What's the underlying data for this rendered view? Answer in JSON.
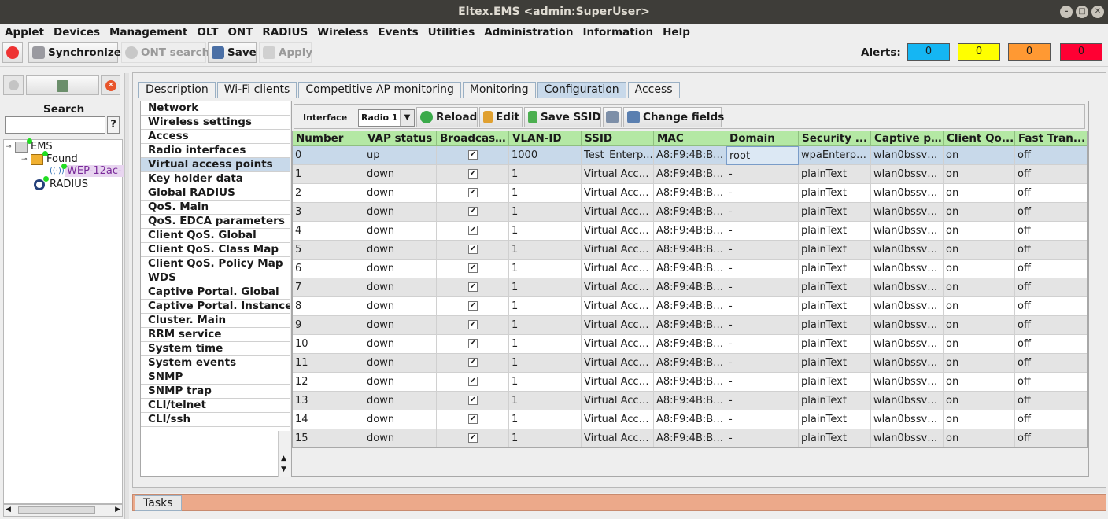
{
  "window": {
    "title": "Eltex.EMS <admin:SuperUser>"
  },
  "menu": [
    "Applet",
    "Devices",
    "Management",
    "OLT",
    "ONT",
    "RADIUS",
    "Wireless",
    "Events",
    "Utilities",
    "Administration",
    "Information",
    "Help"
  ],
  "toolbar": {
    "synchronize": "Synchronize",
    "ont_search": "ONT search",
    "save": "Save",
    "apply": "Apply"
  },
  "alerts": {
    "label": "Alerts:",
    "values": [
      "0",
      "0",
      "0",
      "0"
    ],
    "colors": [
      "#15b6f3",
      "#ffff00",
      "#ff9933",
      "#ff0033"
    ]
  },
  "left": {
    "search_label": "Search",
    "search_btn": "?",
    "tree": {
      "root": "EMS",
      "found": "Found",
      "device": "WEP-12ac-",
      "radius": "RADIUS"
    }
  },
  "tabs": [
    "Description",
    "Wi-Fi clients",
    "Competitive AP monitoring",
    "Monitoring",
    "Configuration",
    "Access"
  ],
  "active_tab": "Configuration",
  "nav": [
    "Network",
    "Wireless settings",
    "Access",
    "Radio interfaces",
    "Virtual access points",
    "Key holder data",
    "Global RADIUS",
    "QoS. Main",
    "QoS. EDCA parameters",
    "Client QoS. Global",
    "Client QoS. Class Map",
    "Client QoS. Policy Map",
    "WDS",
    "Captive Portal. Global",
    "Captive Portal. Instance",
    "Cluster. Main",
    "RRM service",
    "System time",
    "System events",
    "SNMP",
    "SNMP trap",
    "CLI/telnet",
    "CLI/ssh"
  ],
  "selected_nav": "Virtual access points",
  "iface": {
    "label": "Interface",
    "value": "Radio 1",
    "reload": "Reload",
    "edit": "Edit",
    "save_ssid": "Save SSID",
    "change_fields": "Change fields"
  },
  "table": {
    "columns": [
      "Number",
      "VAP status",
      "Broadcast...",
      "VLAN-ID",
      "SSID",
      "MAC",
      "Domain",
      "Security ...",
      "Captive p...",
      "Client Qo...",
      "Fast Tran..."
    ],
    "rows": [
      [
        "0",
        "up",
        "✔",
        "1000",
        "Test_Enterp...",
        "A8:F9:4B:B0...",
        "root",
        "wpaEnterpri...",
        "wlan0bssvap0",
        "on",
        "off"
      ],
      [
        "1",
        "down",
        "✔",
        "1",
        "Virtual Acce...",
        "A8:F9:4B:B0...",
        "-",
        "plainText",
        "wlan0bssvap1",
        "on",
        "off"
      ],
      [
        "2",
        "down",
        "✔",
        "1",
        "Virtual Acce...",
        "A8:F9:4B:B0...",
        "-",
        "plainText",
        "wlan0bssvap2",
        "on",
        "off"
      ],
      [
        "3",
        "down",
        "✔",
        "1",
        "Virtual Acce...",
        "A8:F9:4B:B0...",
        "-",
        "plainText",
        "wlan0bssvap3",
        "on",
        "off"
      ],
      [
        "4",
        "down",
        "✔",
        "1",
        "Virtual Acce...",
        "A8:F9:4B:B0...",
        "-",
        "plainText",
        "wlan0bssvap4",
        "on",
        "off"
      ],
      [
        "5",
        "down",
        "✔",
        "1",
        "Virtual Acce...",
        "A8:F9:4B:B0...",
        "-",
        "plainText",
        "wlan0bssvap5",
        "on",
        "off"
      ],
      [
        "6",
        "down",
        "✔",
        "1",
        "Virtual Acce...",
        "A8:F9:4B:B0...",
        "-",
        "plainText",
        "wlan0bssvap6",
        "on",
        "off"
      ],
      [
        "7",
        "down",
        "✔",
        "1",
        "Virtual Acce...",
        "A8:F9:4B:B0...",
        "-",
        "plainText",
        "wlan0bssvap7",
        "on",
        "off"
      ],
      [
        "8",
        "down",
        "✔",
        "1",
        "Virtual Acce...",
        "A8:F9:4B:B0...",
        "-",
        "plainText",
        "wlan0bssvap8",
        "on",
        "off"
      ],
      [
        "9",
        "down",
        "✔",
        "1",
        "Virtual Acce...",
        "A8:F9:4B:B0...",
        "-",
        "plainText",
        "wlan0bssvap9",
        "on",
        "off"
      ],
      [
        "10",
        "down",
        "✔",
        "1",
        "Virtual Acce...",
        "A8:F9:4B:B0...",
        "-",
        "plainText",
        "wlan0bssva...",
        "on",
        "off"
      ],
      [
        "11",
        "down",
        "✔",
        "1",
        "Virtual Acce...",
        "A8:F9:4B:B0...",
        "-",
        "plainText",
        "wlan0bssva...",
        "on",
        "off"
      ],
      [
        "12",
        "down",
        "✔",
        "1",
        "Virtual Acce...",
        "A8:F9:4B:B0...",
        "-",
        "plainText",
        "wlan0bssva...",
        "on",
        "off"
      ],
      [
        "13",
        "down",
        "✔",
        "1",
        "Virtual Acce...",
        "A8:F9:4B:B0...",
        "-",
        "plainText",
        "wlan0bssva...",
        "on",
        "off"
      ],
      [
        "14",
        "down",
        "✔",
        "1",
        "Virtual Acce...",
        "A8:F9:4B:B0...",
        "-",
        "plainText",
        "wlan0bssva...",
        "on",
        "off"
      ],
      [
        "15",
        "down",
        "✔",
        "1",
        "Virtual Acce...",
        "A8:F9:4B:B0...",
        "-",
        "plainText",
        "wlan0bssva...",
        "on",
        "off"
      ]
    ]
  },
  "footer": {
    "tasks": "Tasks"
  }
}
